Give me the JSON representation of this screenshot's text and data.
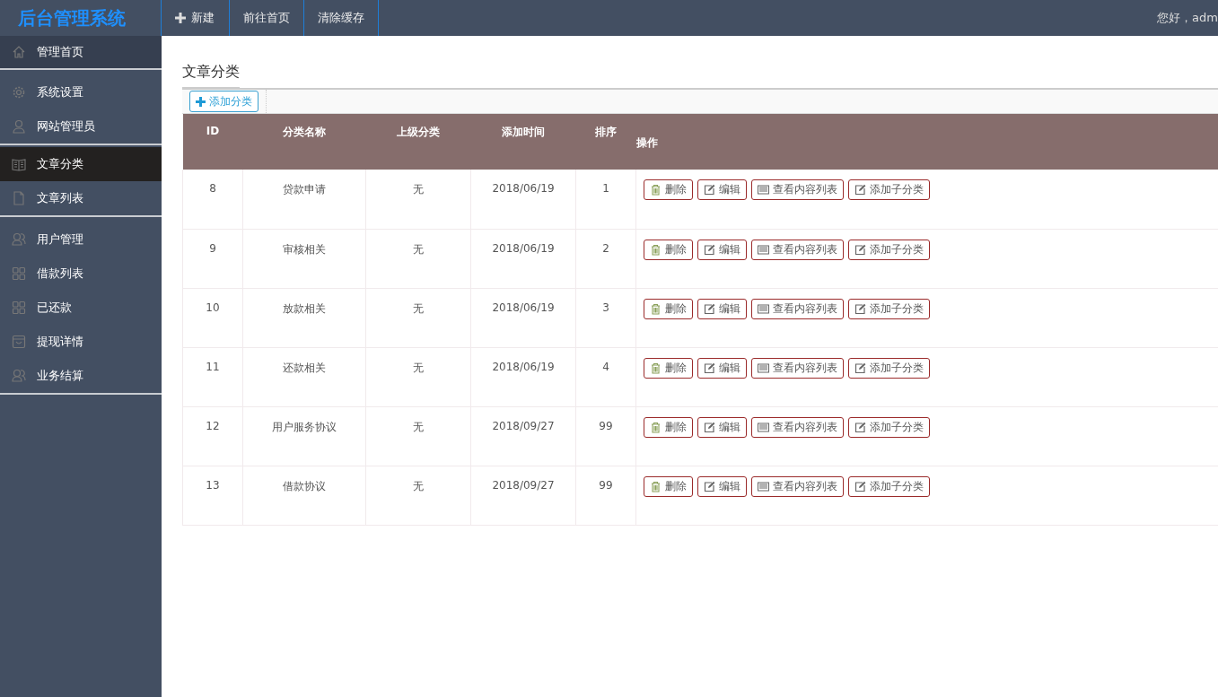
{
  "topbar": {
    "logo": "后台管理系统",
    "nav": [
      {
        "kind": "new",
        "label": "新建"
      },
      {
        "kind": "link",
        "label": "前往首页"
      },
      {
        "kind": "link",
        "label": "清除缓存"
      }
    ],
    "greeting": "您好，adm"
  },
  "sidebar": {
    "groups": [
      {
        "items": [
          {
            "kind": "home",
            "label": "管理首页",
            "selected": false
          }
        ]
      },
      {
        "items": [
          {
            "kind": "gear",
            "label": "系统设置",
            "selected": false
          },
          {
            "kind": "user",
            "label": "网站管理员",
            "selected": false
          }
        ]
      },
      {
        "items": [
          {
            "kind": "book",
            "label": "文章分类",
            "selected": true
          },
          {
            "kind": "file",
            "label": "文章列表",
            "selected": false
          }
        ]
      },
      {
        "items": [
          {
            "kind": "users",
            "label": "用户管理",
            "selected": false
          },
          {
            "kind": "grid",
            "label": "借款列表",
            "selected": false
          },
          {
            "kind": "grid",
            "label": "已还款",
            "selected": false
          },
          {
            "kind": "box",
            "label": "提现详情",
            "selected": false
          },
          {
            "kind": "users",
            "label": "业务结算",
            "selected": false
          }
        ]
      }
    ]
  },
  "page": {
    "title": "文章分类",
    "add_button": "添加分类"
  },
  "table": {
    "columns": [
      "ID",
      "分类名称",
      "上级分类",
      "添加时间",
      "排序",
      "操作"
    ],
    "rows": [
      {
        "cells": [
          "8",
          "贷款申请",
          "无",
          "2018/06/19",
          "1"
        ],
        "actions": [
          {
            "kind": "delete",
            "label": "删除"
          },
          {
            "kind": "edit",
            "label": "编辑"
          },
          {
            "kind": "list",
            "label": "查看内容列表"
          },
          {
            "kind": "edit",
            "label": "添加子分类"
          }
        ]
      },
      {
        "cells": [
          "9",
          "审核相关",
          "无",
          "2018/06/19",
          "2"
        ],
        "actions": [
          {
            "kind": "delete",
            "label": "删除"
          },
          {
            "kind": "edit",
            "label": "编辑"
          },
          {
            "kind": "list",
            "label": "查看内容列表"
          },
          {
            "kind": "edit",
            "label": "添加子分类"
          }
        ]
      },
      {
        "cells": [
          "10",
          "放款相关",
          "无",
          "2018/06/19",
          "3"
        ],
        "actions": [
          {
            "kind": "delete",
            "label": "删除"
          },
          {
            "kind": "edit",
            "label": "编辑"
          },
          {
            "kind": "list",
            "label": "查看内容列表"
          },
          {
            "kind": "edit",
            "label": "添加子分类"
          }
        ]
      },
      {
        "cells": [
          "11",
          "还款相关",
          "无",
          "2018/06/19",
          "4"
        ],
        "actions": [
          {
            "kind": "delete",
            "label": "删除"
          },
          {
            "kind": "edit",
            "label": "编辑"
          },
          {
            "kind": "list",
            "label": "查看内容列表"
          },
          {
            "kind": "edit",
            "label": "添加子分类"
          }
        ]
      },
      {
        "cells": [
          "12",
          "用户服务协议",
          "无",
          "2018/09/27",
          "99"
        ],
        "actions": [
          {
            "kind": "delete",
            "label": "删除"
          },
          {
            "kind": "edit",
            "label": "编辑"
          },
          {
            "kind": "list",
            "label": "查看内容列表"
          },
          {
            "kind": "edit",
            "label": "添加子分类"
          }
        ]
      },
      {
        "cells": [
          "13",
          "借款协议",
          "无",
          "2018/09/27",
          "99"
        ],
        "actions": [
          {
            "kind": "delete",
            "label": "删除"
          },
          {
            "kind": "edit",
            "label": "编辑"
          },
          {
            "kind": "list",
            "label": "查看内容列表"
          },
          {
            "kind": "edit",
            "label": "添加子分类"
          }
        ]
      }
    ]
  }
}
